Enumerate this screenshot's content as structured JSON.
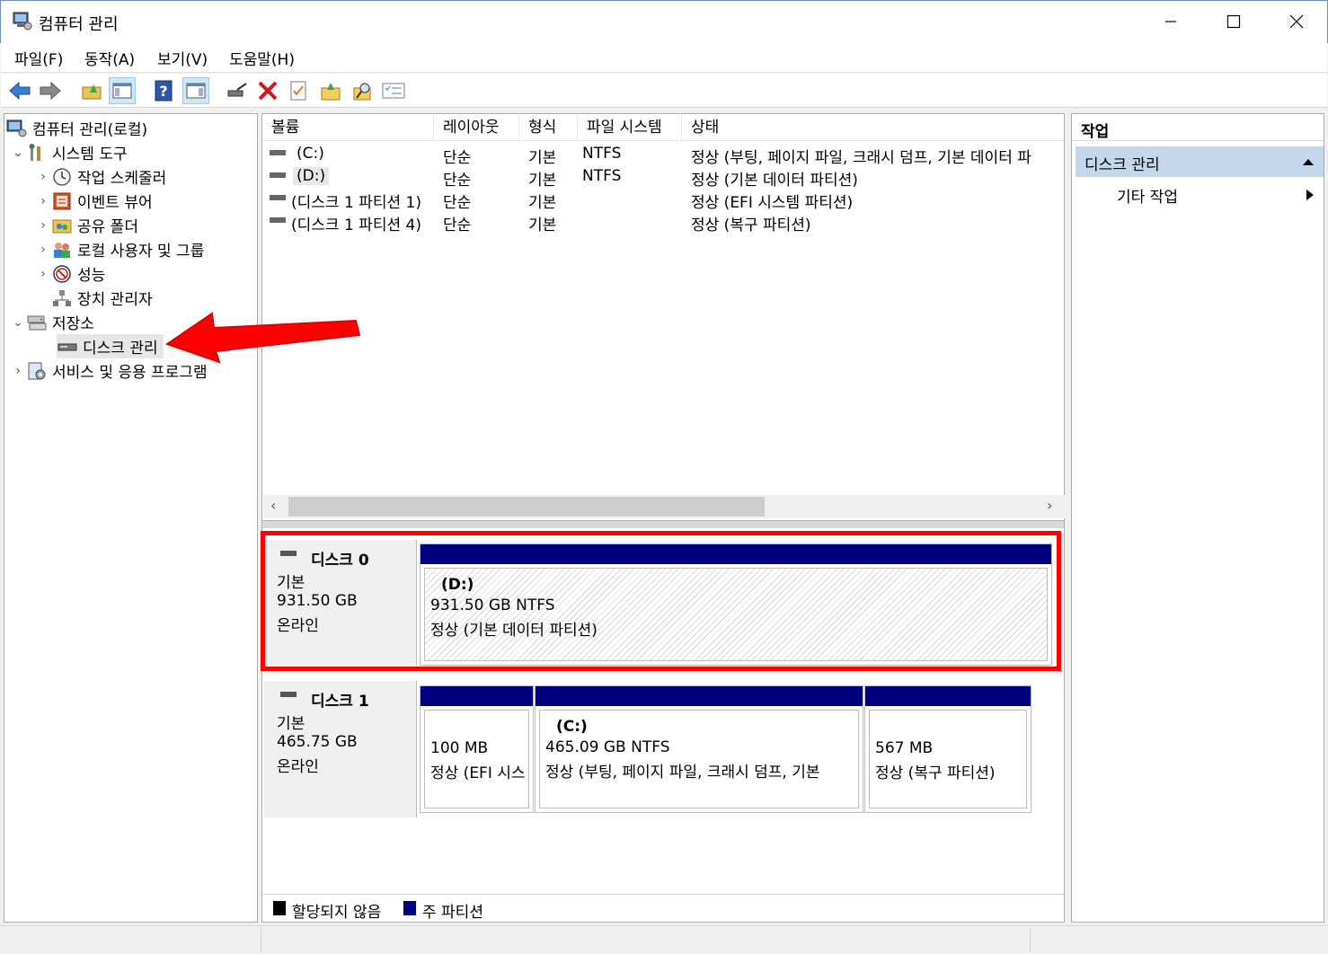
{
  "window": {
    "title": "컴퓨터 관리"
  },
  "menu": [
    "파일(F)",
    "동작(A)",
    "보기(V)",
    "도움말(H)"
  ],
  "tree": {
    "root": "컴퓨터 관리(로컬)",
    "system_tools": "시스템 도구",
    "task_scheduler": "작업 스케줄러",
    "event_viewer": "이벤트 뷰어",
    "shared_folders": "공유 폴더",
    "local_users": "로컬 사용자 및 그룹",
    "performance": "성능",
    "device_manager": "장치 관리자",
    "storage": "저장소",
    "disk_management": "디스크 관리",
    "services_apps": "서비스 및 응용 프로그램"
  },
  "volumes": {
    "columns": [
      "볼륨",
      "레이아웃",
      "형식",
      "파일 시스템",
      "상태"
    ],
    "rows": [
      {
        "name": "(C:)",
        "layout": "단순",
        "type": "기본",
        "fs": "NTFS",
        "status": "정상 (부팅, 페이지 파일, 크래시 덤프, 기본 데이터 파"
      },
      {
        "name": "(D:)",
        "layout": "단순",
        "type": "기본",
        "fs": "NTFS",
        "status": "정상 (기본 데이터 파티션)"
      },
      {
        "name": "(디스크 1 파티션 1)",
        "layout": "단순",
        "type": "기본",
        "fs": "",
        "status": "정상 (EFI 시스템 파티션)"
      },
      {
        "name": "(디스크 1 파티션 4)",
        "layout": "단순",
        "type": "기본",
        "fs": "",
        "status": "정상 (복구 파티션)"
      }
    ]
  },
  "disks": [
    {
      "name": "디스크 0",
      "kind": "기본",
      "size": "931.50 GB",
      "state": "온라인",
      "partitions": [
        {
          "label": "(D:)",
          "size": "931.50 GB NTFS",
          "status": "정상 (기본 데이터 파티션)"
        }
      ]
    },
    {
      "name": "디스크 1",
      "kind": "기본",
      "size": "465.75 GB",
      "state": "온라인",
      "partitions": [
        {
          "label": "",
          "size": "100 MB",
          "status": "정상 (EFI 시스"
        },
        {
          "label": "(C:)",
          "size": "465.09 GB NTFS",
          "status": "정상 (부팅, 페이지 파일, 크래시 덤프, 기본"
        },
        {
          "label": "",
          "size": "567 MB",
          "status": "정상 (복구 파티션)"
        }
      ]
    }
  ],
  "legend": {
    "unallocated": "할당되지 않음",
    "primary": "주 파티션"
  },
  "actions": {
    "header": "작업",
    "section": "디스크 관리",
    "more": "기타 작업"
  },
  "colors": {
    "primary_partition": "#000080",
    "highlight": "#ff0000",
    "arrow": "#ff0000"
  }
}
